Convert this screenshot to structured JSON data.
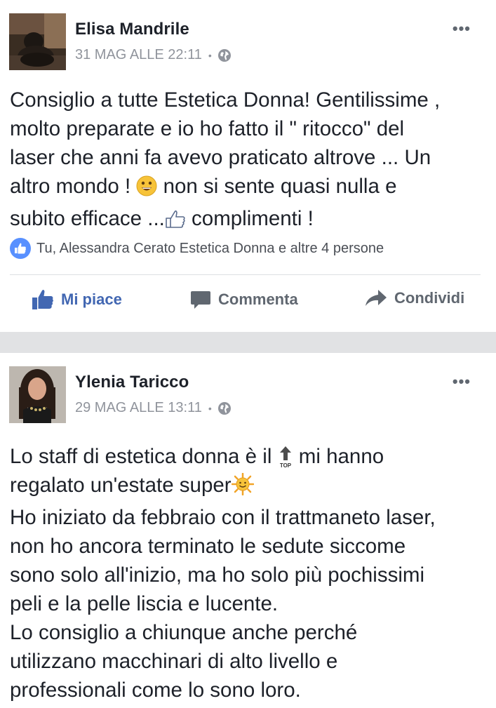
{
  "posts": [
    {
      "author": "Elisa Mandrile",
      "timestamp": "31 MAG ALLE 22:11",
      "separator": "•",
      "privacy_icon": "globe-icon",
      "more_label": "•••",
      "text_lines": [
        "Consiglio a tutte Estetica Donna! Gentilissime ,",
        "molto preparate e io ho fatto il \" ritocco\" del",
        "laser che anni fa avevo praticato altrove ... Un"
      ],
      "text_line4_a": "altro mondo ! ",
      "text_line4_b": " non si sente quasi nulla e",
      "text_line5_a": "subito efficace ...",
      "text_line5_b": "  complimenti !",
      "reactions": "Tu, Alessandra Cerato Estetica Donna e altre 4 persone",
      "actions": {
        "like": "Mi piace",
        "comment": "Commenta",
        "share": "Condividi"
      }
    },
    {
      "author": "Ylenia Taricco",
      "timestamp": "29 MAG ALLE 13:11",
      "separator": "•",
      "privacy_icon": "globe-icon",
      "more_label": "•••",
      "line1_a": "Lo staff di estetica donna è il ",
      "line1_b": " mi hanno",
      "top_label": "TOP",
      "line2": "regalato un'estate super",
      "text_lines": [
        "Ho iniziato da febbraio con il trattmaneto laser,",
        "non ho ancora terminato le sedute siccome",
        "sono solo all'inizio, ma ho solo più pochissimi",
        "peli e la pelle liscia e lucente.",
        "Lo consiglio a chiunque anche perché",
        "utilizzano macchinari di alto livello e",
        "professionali come lo sono loro."
      ]
    }
  ],
  "colors": {
    "link_blue": "#4267b2",
    "like_badge": "#5890ff",
    "meta_gray": "#90949c",
    "divider": "#e1e2e4"
  }
}
